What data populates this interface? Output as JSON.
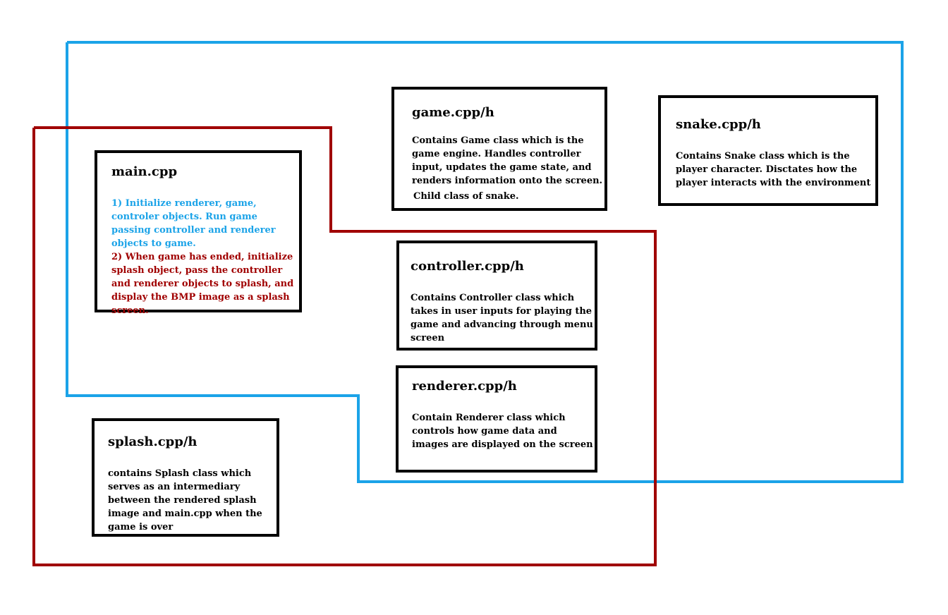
{
  "colors": {
    "blue_group": "#1ba3e8",
    "red_group": "#a00000",
    "box_border": "#000000"
  },
  "boxes": {
    "main": {
      "title": "main.cpp",
      "step1": "1) Initialize renderer, game, controler objects. Run game passing controller and renderer objects to game.",
      "step2": "2) When game has ended, initialize splash object, pass the controller and renderer objects to splash, and display the BMP image as a splash screen."
    },
    "game": {
      "title": "game.cpp/h",
      "description": "Contains Game class which is the game engine. Handles controller input, updates the game state, and renders information onto the screen.",
      "note": "Child class of snake."
    },
    "snake": {
      "title": "snake.cpp/h",
      "description": "Contains Snake class which is the player character. Disctates how the player interacts with the environment"
    },
    "controller": {
      "title": "controller.cpp/h",
      "description": "Contains Controller class which takes in user inputs for playing the game and advancing through menu screen"
    },
    "renderer": {
      "title": "renderer.cpp/h",
      "description": "Contain Renderer class which controls how game data and images are displayed on the screen"
    },
    "splash": {
      "title": "splash.cpp/h",
      "description": "contains Splash class which serves as an intermediary between the rendered splash image and main.cpp when the game is over"
    }
  }
}
